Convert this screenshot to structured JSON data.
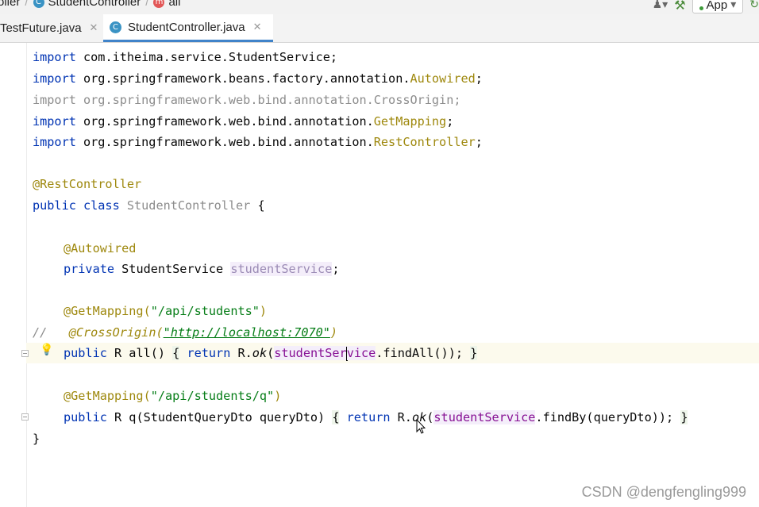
{
  "breadcrumbs": {
    "part1": "oller",
    "part2": "StudentController",
    "part3": "all"
  },
  "toolbar": {
    "run_config_label": "App"
  },
  "tabs": [
    {
      "label": "TestFuture.java"
    },
    {
      "label": "StudentController.java"
    }
  ],
  "code": {
    "imports": [
      {
        "kw": "import",
        "pkg": " com.itheima.service.StudentService",
        "cls": "",
        "end": ";"
      },
      {
        "kw": "import",
        "pkg": " org.springframework.beans.factory.annotation.",
        "cls": "Autowired",
        "end": ";"
      },
      {
        "kw": "import",
        "pkg": " org.springframework.web.bind.annotation.CrossOrigin",
        "cls": "",
        "end": ";"
      },
      {
        "kw": "import",
        "pkg": " org.springframework.web.bind.annotation.",
        "cls": "GetMapping",
        "end": ";"
      },
      {
        "kw": "import",
        "pkg": " org.springframework.web.bind.annotation.",
        "cls": "RestController",
        "end": ";"
      }
    ],
    "class_annotation": "@RestController",
    "class_decl": {
      "kw": "public class",
      "name": " StudentController",
      "brace": " {"
    },
    "field_annotation": "@Autowired",
    "field_decl": {
      "kw": "private",
      "type": " StudentService ",
      "name": "studentService",
      "end": ";"
    },
    "mapping1": {
      "ann": "@GetMapping(",
      "path": "\"/api/students\"",
      "close": ")"
    },
    "comment_line": {
      "slashes": "//",
      "ann": "@CrossOrigin(",
      "url": "\"http://localhost:7070\"",
      "close": ")"
    },
    "method1": {
      "kw": "public",
      "sig": " R all() ",
      "body_kw": "return",
      "body_pre": " R.",
      "call": "ok",
      "paren": "(",
      "field_a": "studentSer",
      "field_b": "vice",
      "rest": ".findAll());",
      "open": "{",
      "close": "}"
    },
    "mapping2": {
      "ann": "@GetMapping(",
      "path": "\"/api/students/q\"",
      "close": ")"
    },
    "method2": {
      "kw": "public",
      "sig": " R q(StudentQueryDto queryDto) ",
      "body_kw": "return",
      "body_pre": " R.",
      "call": "ok",
      "paren": "(",
      "field": "studentService",
      "rest": ".findBy(queryDto));",
      "open": "{",
      "close": "}"
    },
    "closing_brace": "}"
  },
  "watermark": "CSDN @dengfengling999"
}
